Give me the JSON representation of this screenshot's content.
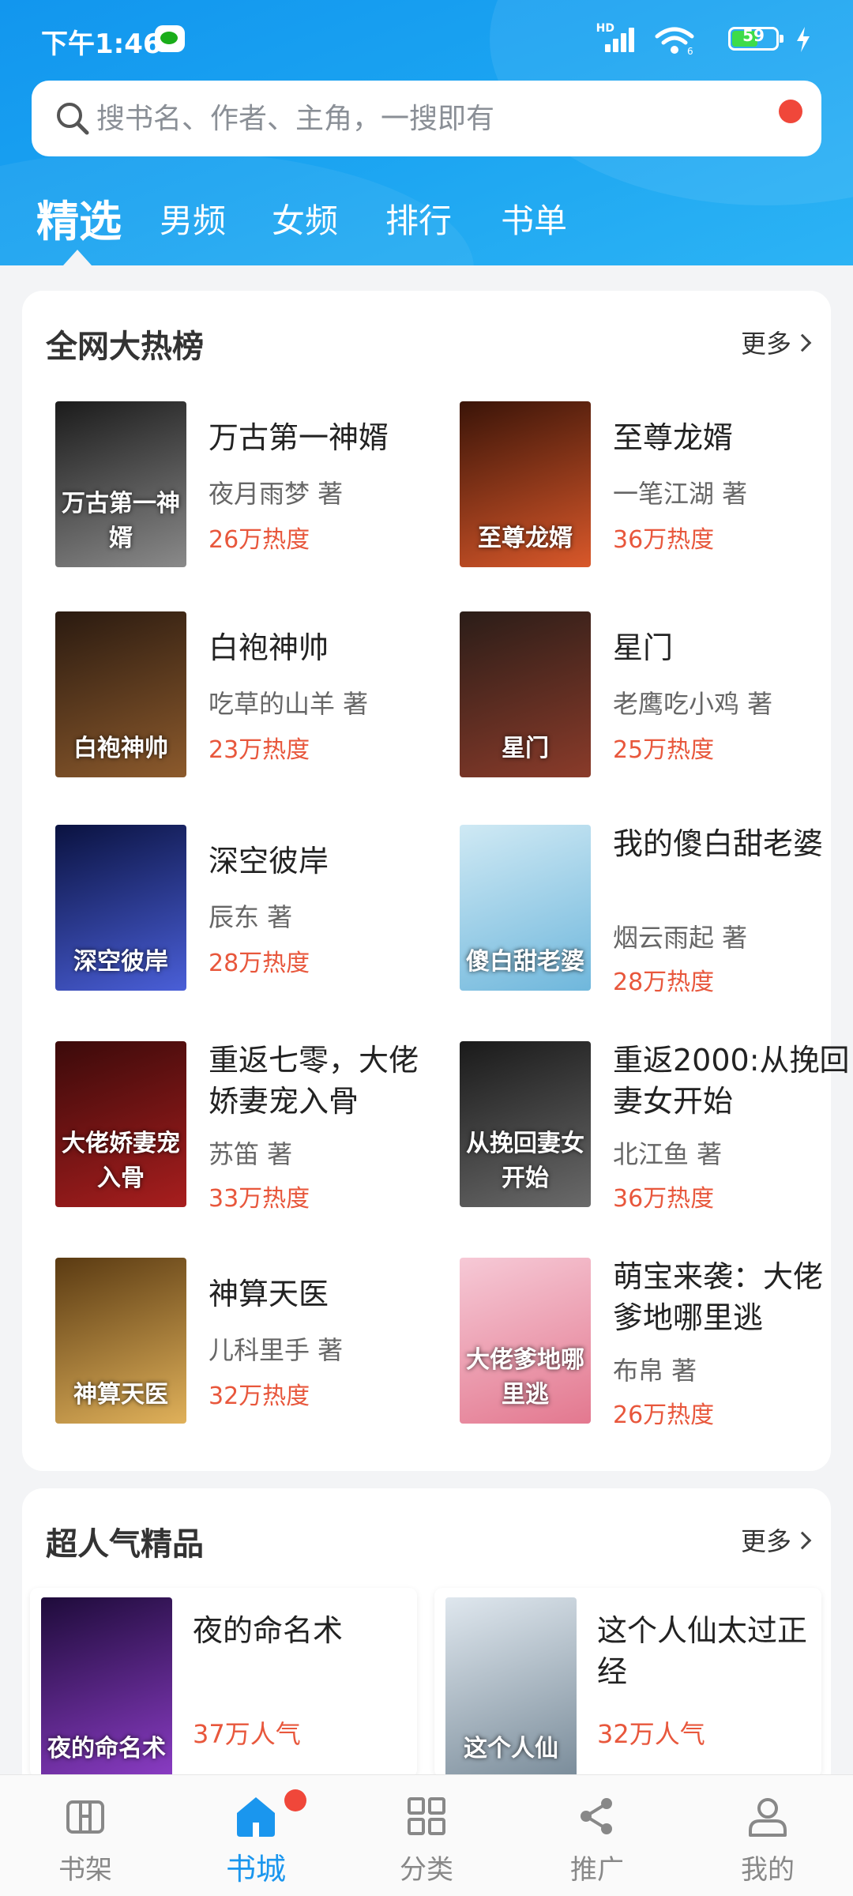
{
  "status_bar": {
    "time": "下午1:46",
    "network": "HD",
    "wifi_label": "6",
    "battery": "59"
  },
  "search": {
    "placeholder": "搜书名、作者、主角，一搜即有"
  },
  "top_tabs": [
    {
      "label": "精选",
      "active": true
    },
    {
      "label": "男频",
      "active": false
    },
    {
      "label": "女频",
      "active": false
    },
    {
      "label": "排行",
      "active": false
    },
    {
      "label": "书单",
      "active": false
    }
  ],
  "hot_list": {
    "title": "全网大热榜",
    "more_label": "更多",
    "books": [
      {
        "title": "万古第一神婿",
        "author": "夜月雨梦 著",
        "heat": "26万热度",
        "cover_text": "万古第一神婿",
        "cover_colors": [
          "#1b1b1b",
          "#8a8a8a"
        ]
      },
      {
        "title": "至尊龙婿",
        "author": "一笔江湖 著",
        "heat": "36万热度",
        "cover_text": "至尊龙婿",
        "cover_colors": [
          "#3a1408",
          "#d9582a"
        ]
      },
      {
        "title": "白袍神帅",
        "author": "吃草的山羊 著",
        "heat": "23万热度",
        "cover_text": "白袍神帅",
        "cover_colors": [
          "#2a1a10",
          "#8c5a2c"
        ]
      },
      {
        "title": "星门",
        "author": "老鹰吃小鸡 著",
        "heat": "25万热度",
        "cover_text": "星门",
        "cover_colors": [
          "#2b1d18",
          "#8a3b2a"
        ]
      },
      {
        "title": "深空彼岸",
        "author": "辰东 著",
        "heat": "28万热度",
        "cover_text": "深空彼岸",
        "cover_colors": [
          "#0a1240",
          "#4a5fd8"
        ]
      },
      {
        "title": "我的傻白甜老婆",
        "author": "烟云雨起 著",
        "heat": "28万热度",
        "cover_text": "傻白甜老婆",
        "cover_colors": [
          "#cfe9f4",
          "#6fb7dc"
        ]
      },
      {
        "title": "重返七零，大佬娇妻宠入骨",
        "author": "苏笛 著",
        "heat": "33万热度",
        "cover_text": "大佬娇妻宠入骨",
        "cover_colors": [
          "#3b0a0a",
          "#a81e1e"
        ]
      },
      {
        "title": "重返2000:从挽回妻女开始",
        "author": "北江鱼 著",
        "heat": "36万热度",
        "cover_text": "从挽回妻女开始",
        "cover_colors": [
          "#1a1a1a",
          "#6a6a6a"
        ]
      },
      {
        "title": "神算天医",
        "author": "儿科里手 著",
        "heat": "32万热度",
        "cover_text": "神算天医",
        "cover_colors": [
          "#5a3a12",
          "#e0b15a"
        ]
      },
      {
        "title": "萌宝来袭：大佬爹地哪里逃",
        "author": "布帛 著",
        "heat": "26万热度",
        "cover_text": "大佬爹地哪里逃",
        "cover_colors": [
          "#f6c9d6",
          "#e3788f"
        ]
      }
    ]
  },
  "popular": {
    "title": "超人气精品",
    "more_label": "更多",
    "books": [
      {
        "title": "夜的命名术",
        "heat": "37万人气",
        "cover_text": "夜的命名术",
        "cover_colors": [
          "#1e0b3a",
          "#8a3cc4"
        ]
      },
      {
        "title": "这个人仙太过正经",
        "heat": "32万人气",
        "cover_text": "这个人仙",
        "cover_colors": [
          "#dfe7ee",
          "#7a8c9a"
        ]
      }
    ]
  },
  "bottom_nav": [
    {
      "label": "书架",
      "icon": "bookshelf-icon",
      "active": false
    },
    {
      "label": "书城",
      "icon": "home-icon",
      "active": true
    },
    {
      "label": "分类",
      "icon": "category-icon",
      "active": false
    },
    {
      "label": "推广",
      "icon": "share-icon",
      "active": false
    },
    {
      "label": "我的",
      "icon": "profile-icon",
      "active": false
    }
  ],
  "colors": {
    "accent": "#1a96ee",
    "heat": "#e8573c",
    "badge": "#f0473a"
  }
}
